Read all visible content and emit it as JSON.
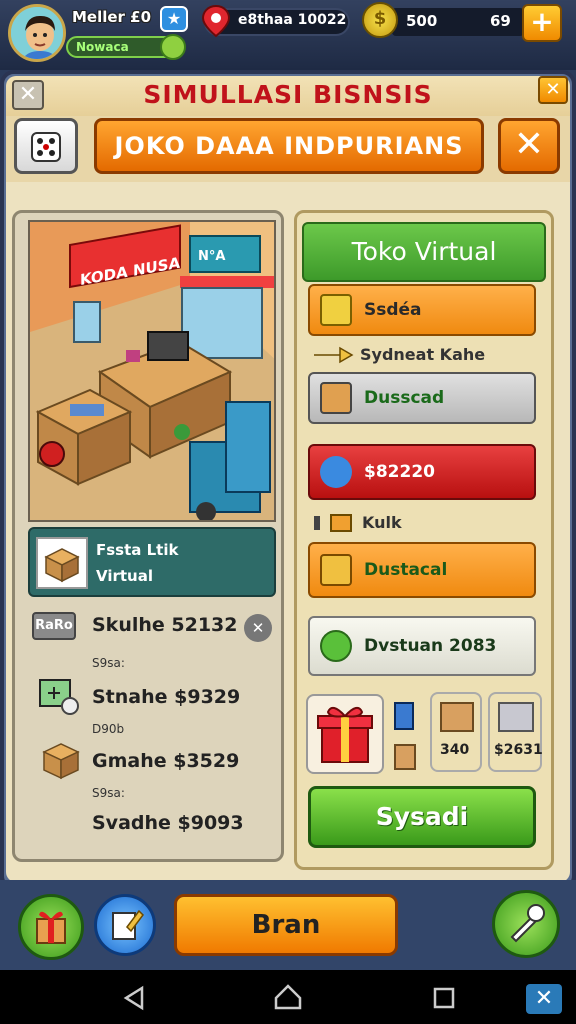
{
  "player": {
    "name": "Meller £0",
    "level_label": "Nowaca"
  },
  "currency": {
    "pin_value": "e8thaa 10022",
    "coin_value": "500",
    "gem_value": "69",
    "plus": "+"
  },
  "header": {
    "title": "SIMULLASI BISNSIS",
    "close": "✕"
  },
  "shop": {
    "name": "JOKO DAAA  INDPURIANS",
    "close": "✕"
  },
  "scene": {
    "sign_left": "KODA NUSA",
    "sign_right": "N°A"
  },
  "store_info": {
    "line1": "Fssta Ltik",
    "line2": "Virtual"
  },
  "left_rows": [
    {
      "tag": "RaRo",
      "value": "Skulhe 52132",
      "close": "✕"
    },
    {
      "sub": "S9sa:",
      "value": "Stnahe $9329"
    },
    {
      "sub": "D90b",
      "value": "Gmahe $3529"
    },
    {
      "sub": "S9sa:",
      "value": "Svadhe $9093"
    }
  ],
  "right": {
    "banner": "Toko Virtual",
    "items": [
      {
        "label": "Ssdéa"
      },
      {
        "label": "Sydneat Kahe"
      },
      {
        "label": "Dusscad"
      },
      {
        "label": "$82220"
      },
      {
        "label": "Kulk"
      },
      {
        "label": "Dustacal"
      },
      {
        "label": "Dvstuan 2083"
      }
    ],
    "small_items": [
      {
        "label": "340"
      },
      {
        "label": "$2631"
      }
    ],
    "confirm": "Sysadi"
  },
  "bottom": {
    "center_button": "Bran"
  },
  "colors": {
    "accent_orange": "#f07a00",
    "accent_green": "#3d9a2a",
    "title_red": "#c0121a",
    "panel_bg": "#ede2c0"
  }
}
